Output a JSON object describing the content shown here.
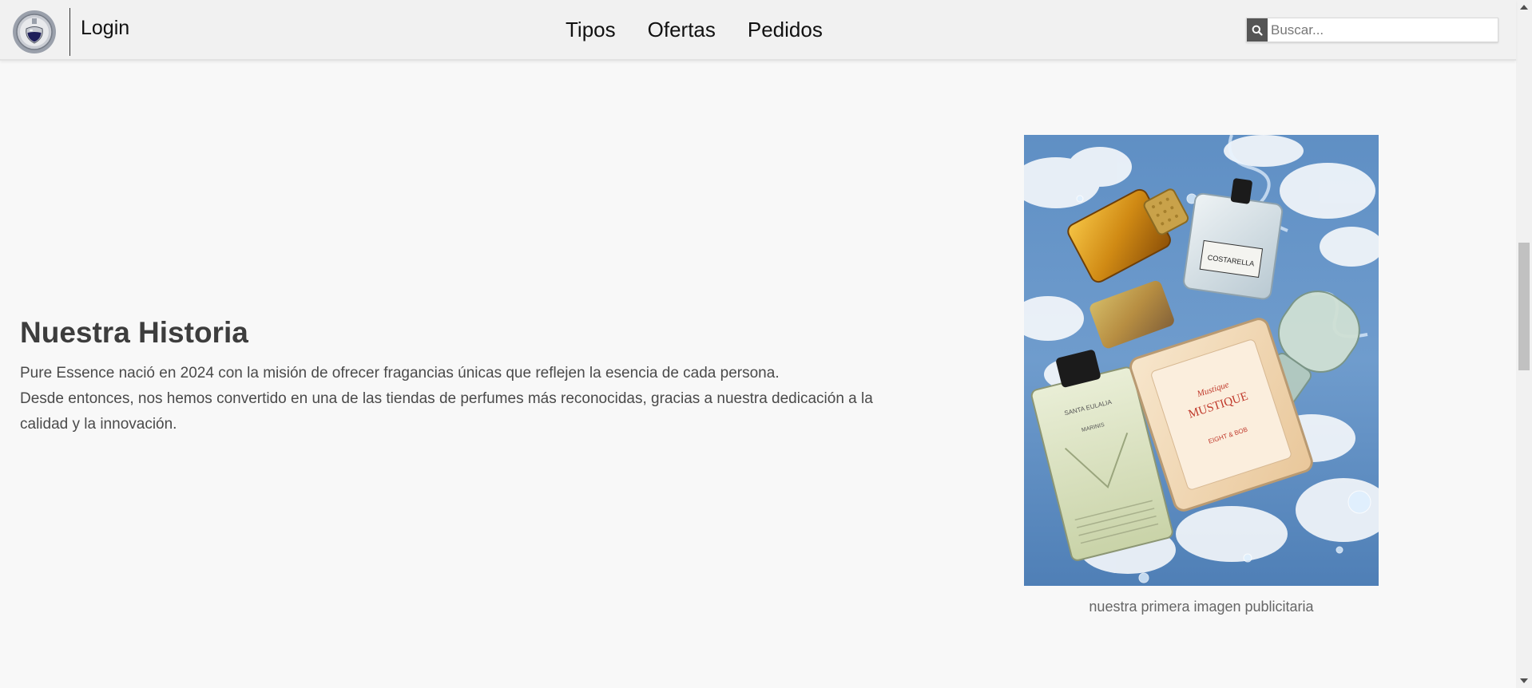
{
  "header": {
    "logo_icon": "perfume-bottle-logo-icon",
    "login_label": "Login",
    "menu": [
      {
        "label": "Tipos"
      },
      {
        "label": "Ofertas"
      },
      {
        "label": "Pedidos"
      }
    ],
    "search": {
      "icon": "search-icon",
      "placeholder": "Buscar...",
      "value": ""
    }
  },
  "history": {
    "title": "Nuestra Historia",
    "paragraph_line1": "Pure Essence nació en 2024 con la misión de ofrecer fragancias únicas que reflejen la esencia de cada persona.",
    "paragraph_line2": "Desde entonces, nos hemos convertido en una de las tiendas de perfumes más reconocidas, gracias a nuestra dedicación a la calidad y la innovación."
  },
  "figure": {
    "image_subject": "perfume bottles on a reflective sky surface",
    "bottle_labels": [
      "COSTARELLA",
      "MUSTIQUE",
      "EIGHT & BOB",
      "SANTA EULALIA",
      "MARINIS"
    ],
    "caption": "nuestra primera imagen publicitaria"
  },
  "colors": {
    "page_bg": "#f8f8f8",
    "navbar_bg": "#f1f1f1",
    "title": "#3d3d3d",
    "body_text": "#4a4a4a",
    "search_button": "#555555"
  }
}
